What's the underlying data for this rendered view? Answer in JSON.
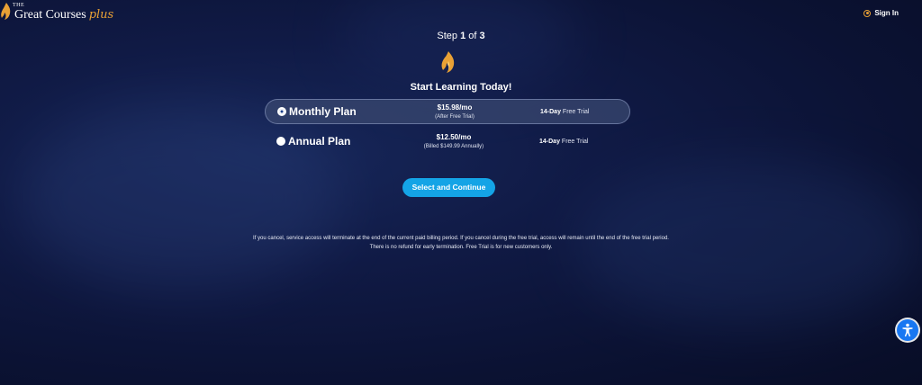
{
  "brand": {
    "the": "THE",
    "name": "Great Courses",
    "plus": "plus",
    "flame_color": "#e9a135"
  },
  "header": {
    "sign_in_label": "Sign In",
    "sign_in_icon": "user-circle-icon"
  },
  "step": {
    "prefix": "Step",
    "current": "1",
    "of": "of",
    "total": "3"
  },
  "headline": "Start Learning Today!",
  "plans": [
    {
      "name": "Monthly Plan",
      "price": "$15.98/mo",
      "sub": "(After Free Trial)",
      "trial_days": "14-Day",
      "trial_text": "Free Trial",
      "selected": true
    },
    {
      "name": "Annual Plan",
      "price": "$12.50/mo",
      "sub": "(Billed $149.99 Annually)",
      "trial_days": "14-Day",
      "trial_text": "Free Trial",
      "selected": false
    }
  ],
  "cta_label": "Select and Continue",
  "legal": {
    "line1": "If you cancel, service access will terminate at the end of the current paid billing period. If you cancel during the free trial, access will remain until the end of the free trial period.",
    "line2": "There is no refund for early termination.  Free Trial is for new customers only."
  },
  "accessibility_icon": "accessibility-icon",
  "colors": {
    "accent": "#14a4e6",
    "brand_orange": "#e9a135",
    "background": "#0b1233",
    "a11y_blue": "#1877f2"
  }
}
